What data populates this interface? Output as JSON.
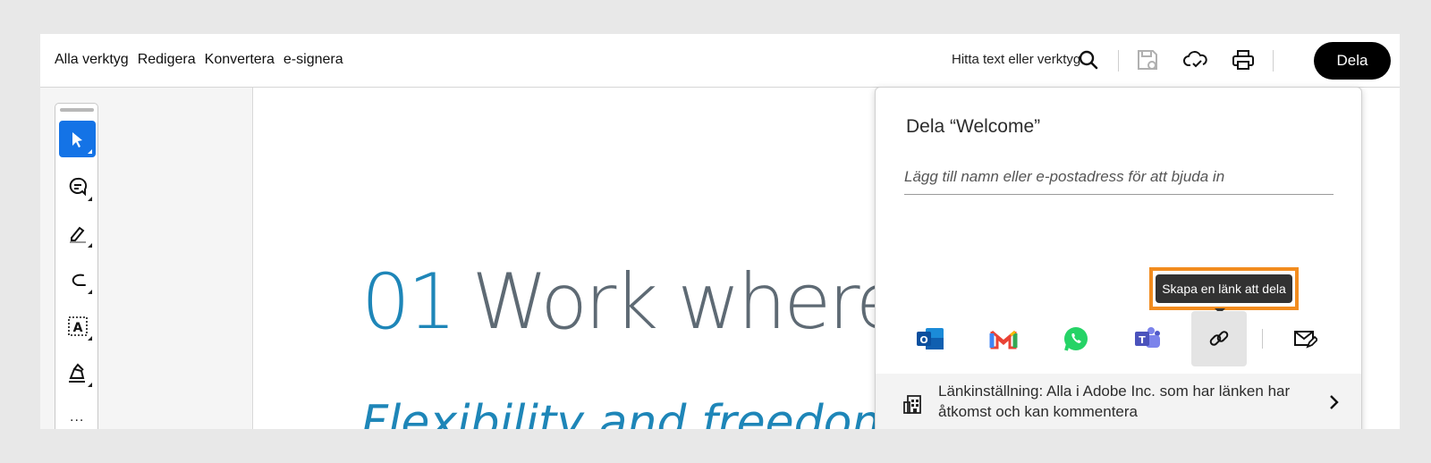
{
  "menu": [
    "Alla verktyg",
    "Redigera",
    "Konvertera",
    "e-signera"
  ],
  "topbar": {
    "find_label": "Hitta text eller verktyg",
    "share_label": "Dela",
    "icons": [
      "search-icon",
      "save-icon",
      "cloud-sync-icon",
      "print-icon"
    ]
  },
  "tools": [
    "select-icon",
    "comment-icon",
    "highlight-icon",
    "draw-icon",
    "text-box-icon",
    "sign-icon"
  ],
  "tools_more": "...",
  "document": {
    "number": "01",
    "heading": "Work where y",
    "subheading": "Flexibility and freedom"
  },
  "share_panel": {
    "title": "Dela “Welcome”",
    "invite_placeholder": "Lägg till namn eller e-postadress för att bjuda in",
    "tooltip": "Skapa en länk att dela",
    "share_targets": [
      "outlook-icon",
      "gmail-icon",
      "whatsapp-icon",
      "teams-icon",
      "link-icon",
      "email-icon"
    ],
    "link_setting": "Länkinställning: Alla i Adobe Inc. som har länken har åtkomst och kan kommentera"
  },
  "colors": {
    "accent": "#1473e6",
    "highlight": "#f28c1e",
    "heading_number": "#1e86b8"
  }
}
